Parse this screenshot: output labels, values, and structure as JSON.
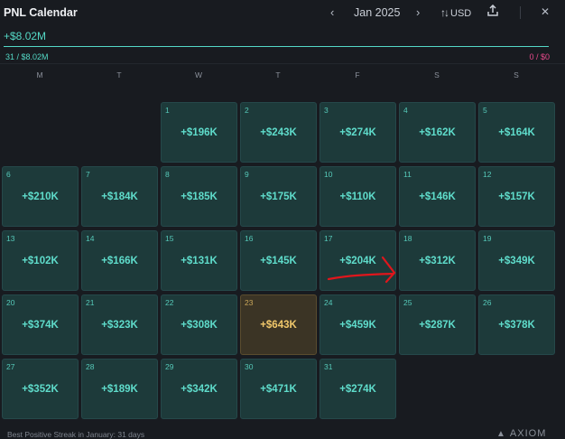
{
  "header": {
    "title": "PNL Calendar",
    "prev_glyph": "‹",
    "next_glyph": "›",
    "month": "Jan 2025",
    "currency": "USD",
    "currency_icon": "sort-arrows-icon",
    "share_icon": "share-icon",
    "close_icon": "close-icon",
    "close_glyph": "✕"
  },
  "summary": {
    "total": "+$8.02M",
    "wins": "31 / $8.02M",
    "losses": "0 / $0",
    "win_color": "#54d9c6",
    "loss_color": "#e84a8c"
  },
  "weekdays": [
    "M",
    "T",
    "W",
    "T",
    "F",
    "S",
    "S"
  ],
  "days": [
    {
      "day": "1",
      "value": "+$196K"
    },
    {
      "day": "2",
      "value": "+$243K"
    },
    {
      "day": "3",
      "value": "+$274K"
    },
    {
      "day": "4",
      "value": "+$162K"
    },
    {
      "day": "5",
      "value": "+$164K"
    },
    {
      "day": "6",
      "value": "+$210K"
    },
    {
      "day": "7",
      "value": "+$184K"
    },
    {
      "day": "8",
      "value": "+$185K"
    },
    {
      "day": "9",
      "value": "+$175K"
    },
    {
      "day": "10",
      "value": "+$110K"
    },
    {
      "day": "11",
      "value": "+$146K"
    },
    {
      "day": "12",
      "value": "+$157K"
    },
    {
      "day": "13",
      "value": "+$102K"
    },
    {
      "day": "14",
      "value": "+$166K"
    },
    {
      "day": "15",
      "value": "+$131K"
    },
    {
      "day": "16",
      "value": "+$145K"
    },
    {
      "day": "17",
      "value": "+$204K"
    },
    {
      "day": "18",
      "value": "+$312K"
    },
    {
      "day": "19",
      "value": "+$349K"
    },
    {
      "day": "20",
      "value": "+$374K"
    },
    {
      "day": "21",
      "value": "+$323K"
    },
    {
      "day": "22",
      "value": "+$308K"
    },
    {
      "day": "23",
      "value": "+$643K",
      "highlight": true
    },
    {
      "day": "24",
      "value": "+$459K"
    },
    {
      "day": "25",
      "value": "+$287K"
    },
    {
      "day": "26",
      "value": "+$378K"
    },
    {
      "day": "27",
      "value": "+$352K"
    },
    {
      "day": "28",
      "value": "+$189K"
    },
    {
      "day": "29",
      "value": "+$342K"
    },
    {
      "day": "30",
      "value": "+$471K"
    },
    {
      "day": "31",
      "value": "+$274K"
    }
  ],
  "footer": {
    "streak": "Best Positive Streak in January: 31 days",
    "logo": "AXIOM"
  },
  "annotation": {
    "type": "red-arrow-icon",
    "color": "#e0161c"
  }
}
